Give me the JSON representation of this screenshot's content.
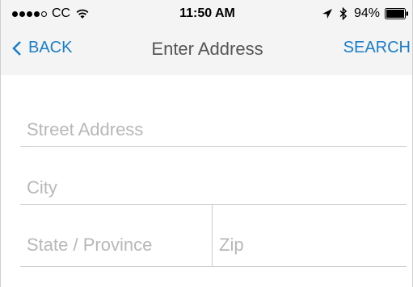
{
  "status_bar": {
    "carrier": "CC",
    "time": "11:50 AM",
    "battery": "94%",
    "icons": [
      "signal-dots-icon",
      "wifi-icon",
      "location-arrow-icon",
      "bluetooth-icon",
      "battery-icon"
    ]
  },
  "nav": {
    "back_label": "BACK",
    "title": "Enter Address",
    "search_label": "SEARCH",
    "accent_color": "#1a7ec8"
  },
  "form": {
    "street": {
      "placeholder": "Street Address",
      "value": ""
    },
    "city": {
      "placeholder": "City",
      "value": ""
    },
    "state": {
      "placeholder": "State / Province",
      "value": ""
    },
    "zip": {
      "placeholder": "Zip",
      "value": ""
    }
  }
}
